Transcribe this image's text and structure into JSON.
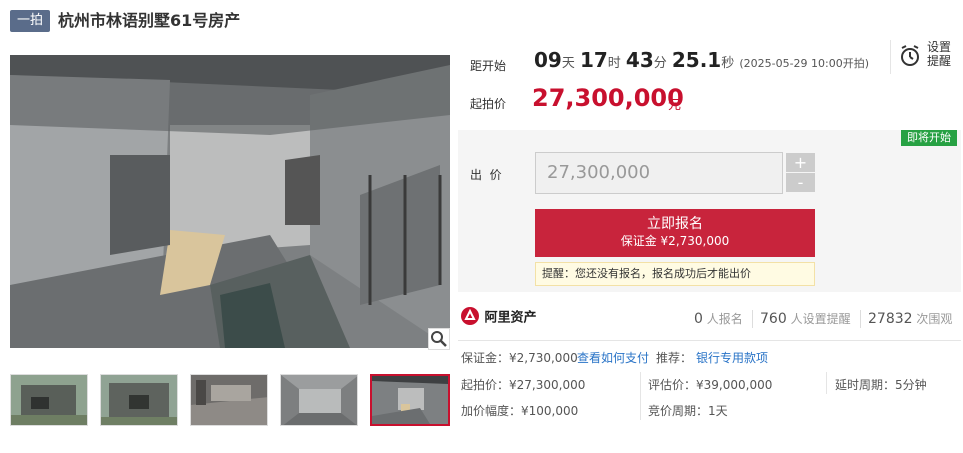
{
  "header": {
    "badge": "一拍",
    "title": "杭州市林语别墅61号房产"
  },
  "countdown": {
    "label": "距开始",
    "days": "09",
    "days_unit": "天",
    "hours": "17",
    "hours_unit": "时",
    "minutes": "43",
    "minutes_unit": "分",
    "seconds": "25.1",
    "seconds_unit": "秒",
    "start_note": "(2025-05-29 10:00开拍)"
  },
  "reminder": {
    "label_line1": "设置",
    "label_line2": "提醒"
  },
  "start_price": {
    "label": "起拍价",
    "value": "27,300,000",
    "unit": "元"
  },
  "status_tag": "即将开始",
  "bid": {
    "label": "出  价",
    "value": "27,300,000",
    "plus": "+",
    "minus": "-",
    "signup_line1": "立即报名",
    "signup_line2": "保证金 ¥2,730,000",
    "tip": "提醒：您还没有报名，报名成功后才能出价"
  },
  "brand": {
    "name": "阿里资产"
  },
  "stats": {
    "signups": "0",
    "signups_label": "人报名",
    "reminders": "760",
    "reminders_label": "人设置提醒",
    "views": "27832",
    "views_label": "次围观"
  },
  "details": {
    "deposit_label": "保证金：¥2,730,000",
    "pay_link": "查看如何支付",
    "recommend_label": "推荐：",
    "recommend_link": "银行专用款项",
    "start_price": "起拍价：¥27,300,000",
    "appraisal": "评估价：¥39,000,000",
    "delay": "延时周期：5分钟",
    "increment": "加价幅度：¥100,000",
    "bid_cycle": "竞价周期：1天"
  },
  "colors": {
    "accent": "#c8102e",
    "button": "#c8243c",
    "tag": "#27a143",
    "link": "#2a74c7"
  },
  "icons": [
    "magnifier-icon",
    "alarm-clock-icon",
    "ali-assets-logo-icon"
  ]
}
